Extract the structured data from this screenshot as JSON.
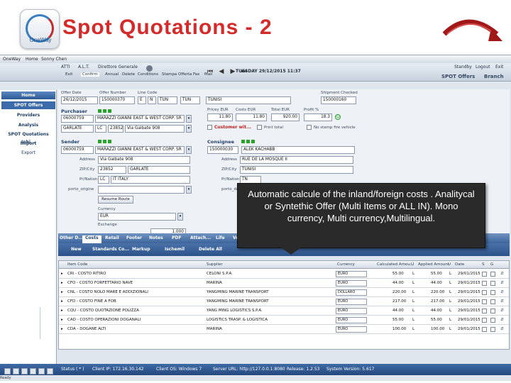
{
  "slide": {
    "title": "Spot Quotations  - 2",
    "logo_text": "OneWay"
  },
  "menubar": [
    "OneWay",
    "Home",
    "Sonny Chen"
  ],
  "toolbar": {
    "user": "ATTI",
    "company": "A.L.T.",
    "extra": "Direttore Generale",
    "date": "TUESDAY 29/12/2015  11:37",
    "buttons": [
      "Exit",
      "Confirm",
      "Annual",
      "Delete",
      "Conditions",
      "Stampa Offerta",
      "Fax",
      "Mail"
    ],
    "right_buttons": [
      "Standby",
      "Logout",
      "Exit"
    ],
    "spot_offers": "SPOT Offers",
    "branch": "Branch"
  },
  "sidebar": {
    "items": [
      "Home",
      "SPOT Offers",
      "Providers",
      "Analysis",
      "SPOT Quotations Inhi...",
      "Import",
      "Export"
    ]
  },
  "form": {
    "offer_date_label": "Offer Date",
    "offer_date": "26/12/2015",
    "offer_number_label": "Offer Number",
    "offer_number": "150000370",
    "line_code_label": "Line Code",
    "line_e": "E",
    "line_n": "N",
    "line_code1": "TUN",
    "line_code2": "TUN",
    "destination": "TUNISI",
    "shipment_label": "Shipment Checked",
    "shipment": "150000160",
    "purchaser_label": "Purchaser",
    "purchaser_code": "06000759",
    "purchaser_name": "MARAZZI GIANNI EAST & WEST CORP. SR",
    "purchaser_city": "GARLATE",
    "purchaser_prov": "LC",
    "purchaser_zip": "23852",
    "purchaser_addr": "Via Galbate 908",
    "price_label": "Pricey  EUR",
    "costs_label": "Costs  EUR",
    "total_label": "Total  EUR",
    "profit_label": "Profit %",
    "price": "11.80",
    "costs": "11.80",
    "total": "920.00",
    "profit": "18.3",
    "customer_label": "Customer wit...",
    "print_total_label": "Print total",
    "no_stamp_label": "No stamp fire vehicle",
    "sender_label": "Sender",
    "sender_code": "06000759",
    "sender_name": "MARAZZI GIANNI EAST & WEST CORP. SR",
    "address_label": "Address",
    "sender_addr": "Via Galbate 908",
    "zip_label": "ZIP/City",
    "sender_zip": "23852",
    "sender_city": "GARLATE",
    "prov_label": "Pr/Nation",
    "sender_prov": "LC",
    "sender_nation": "IT ITALY",
    "porto_label": "porto_origine",
    "consignee_label": "Consignee",
    "consignee_code": "150000030",
    "consignee_name": "ALEK KACHABB",
    "consignee_addr": "RUE DE LA MOSQUE II",
    "consignee_city": "TUNISI",
    "consignee_nation": "TN",
    "porto2_label": "porto_dest...",
    "resume_label": "Resume Route",
    "currency_label": "Currency",
    "currency": "EUR",
    "exchange_label": "Exchange",
    "exchange": "1.000"
  },
  "tabs": [
    "Other D...",
    "Costs",
    "Retail",
    "Footer",
    "Notes",
    "PDF",
    "Attach...",
    "Life",
    "Vo..."
  ],
  "subtabs": [
    "New",
    "Standards Co...",
    "Markup",
    "Ischemil",
    "Delete All"
  ],
  "callout": "Automatic calcule of the inland/foreign costs . Analitycal or Syntethic Offer (Multi Items or ALL IN). Mono currency, Multi currency,Multilingual.",
  "grid": {
    "headers": [
      "Item Code",
      "Supplier",
      "Currency",
      "Calculated Amou...",
      "U",
      "Applied Amount",
      "U",
      "Date",
      "S",
      "G"
    ],
    "rows": [
      [
        "CRI - COSTO RITIRO",
        "CELONI S.P.A.",
        "EURO",
        "55.00",
        "L",
        "55.00",
        "29/01/2015"
      ],
      [
        "CFO - COSTO FORFETTARIO NAVE",
        "MARINA",
        "EURO",
        "44.00",
        "L",
        "44.00",
        "29/01/2015"
      ],
      [
        "CNL - COSTO NOLO MARE E ADDIZIONALI",
        "YANGMING MARINE TRANSPORT",
        "DOLLARO",
        "220.00",
        "L",
        "220.00",
        "29/01/2015"
      ],
      [
        "CFD - COSTO FINE A FOB",
        "YANGMING MARINE TRANSPORT",
        "EURO",
        "217.00",
        "L",
        "217.00",
        "29/01/2015"
      ],
      [
        "CQU - COSTO QUOTAZIONE POLIZZA",
        "YANG MING LOGISTICS S.P.A.",
        "EURO",
        "44.00",
        "L",
        "44.00",
        "29/01/2015"
      ],
      [
        "CAD - COSTO OPERAZIONI DOGANALI",
        "LOGISTICS TRASP. & LOGISTICA",
        "EURO",
        "55.00",
        "L",
        "55.00",
        "29/01/2015"
      ],
      [
        "CDA - DOGANE ALTI",
        "MARINA",
        "EURO",
        "100.00",
        "L",
        "100.00",
        "29/01/2015"
      ]
    ]
  },
  "status": {
    "status": "Status ( * )",
    "client": "Client IP: 172.16.30.142",
    "os": "Client OS: Windows 7",
    "server": "Server URL: http://127.0.0.1:8080",
    "release": "Release: 1.2.53",
    "system": "System Version: 5.617"
  },
  "ready": "Ready",
  "colors": {
    "title_red": "#d42a2a",
    "nav_blue": "#2d5a96",
    "callout_bg": "#2a2a2a"
  }
}
